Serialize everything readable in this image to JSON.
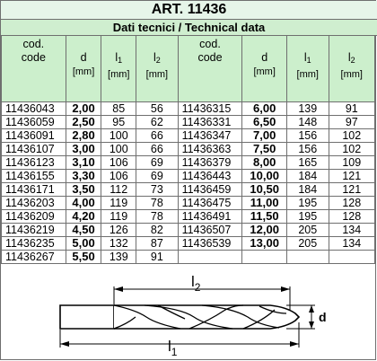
{
  "header": {
    "title": "ART. 11436",
    "subtitle": "Dati tecnici / Technical data"
  },
  "columns": {
    "code_line1": "cod.",
    "code_line2": "code",
    "d_label": "d",
    "l1_label": "l",
    "l1_sub": "1",
    "l2_label": "l",
    "l2_sub": "2",
    "unit": "[mm]"
  },
  "left_rows": [
    {
      "code": "11436043",
      "d": "2,00",
      "l1": "85",
      "l2": "56"
    },
    {
      "code": "11436059",
      "d": "2,50",
      "l1": "95",
      "l2": "62"
    },
    {
      "code": "11436091",
      "d": "2,80",
      "l1": "100",
      "l2": "66"
    },
    {
      "code": "11436107",
      "d": "3,00",
      "l1": "100",
      "l2": "66"
    },
    {
      "code": "11436123",
      "d": "3,10",
      "l1": "106",
      "l2": "69"
    },
    {
      "code": "11436155",
      "d": "3,30",
      "l1": "106",
      "l2": "69"
    },
    {
      "code": "11436171",
      "d": "3,50",
      "l1": "112",
      "l2": "73"
    },
    {
      "code": "11436203",
      "d": "4,00",
      "l1": "119",
      "l2": "78"
    },
    {
      "code": "11436209",
      "d": "4,20",
      "l1": "119",
      "l2": "78"
    },
    {
      "code": "11436219",
      "d": "4,50",
      "l1": "126",
      "l2": "82"
    },
    {
      "code": "11436235",
      "d": "5,00",
      "l1": "132",
      "l2": "87"
    },
    {
      "code": "11436267",
      "d": "5,50",
      "l1": "139",
      "l2": "91"
    }
  ],
  "right_rows": [
    {
      "code": "11436315",
      "d": "6,00",
      "l1": "139",
      "l2": "91"
    },
    {
      "code": "11436331",
      "d": "6,50",
      "l1": "148",
      "l2": "97"
    },
    {
      "code": "11436347",
      "d": "7,00",
      "l1": "156",
      "l2": "102"
    },
    {
      "code": "11436363",
      "d": "7,50",
      "l1": "156",
      "l2": "102"
    },
    {
      "code": "11436379",
      "d": "8,00",
      "l1": "165",
      "l2": "109"
    },
    {
      "code": "11436443",
      "d": "10,00",
      "l1": "184",
      "l2": "121"
    },
    {
      "code": "11436459",
      "d": "10,50",
      "l1": "184",
      "l2": "121"
    },
    {
      "code": "11436475",
      "d": "11,00",
      "l1": "195",
      "l2": "128"
    },
    {
      "code": "11436491",
      "d": "11,50",
      "l1": "195",
      "l2": "128"
    },
    {
      "code": "11436507",
      "d": "12,00",
      "l1": "205",
      "l2": "134"
    },
    {
      "code": "11436539",
      "d": "13,00",
      "l1": "205",
      "l2": "134"
    }
  ],
  "drawing": {
    "l2_label": "l",
    "l2_sub": "2",
    "l1_label": "l",
    "l1_sub": "1",
    "d_label": "d"
  }
}
